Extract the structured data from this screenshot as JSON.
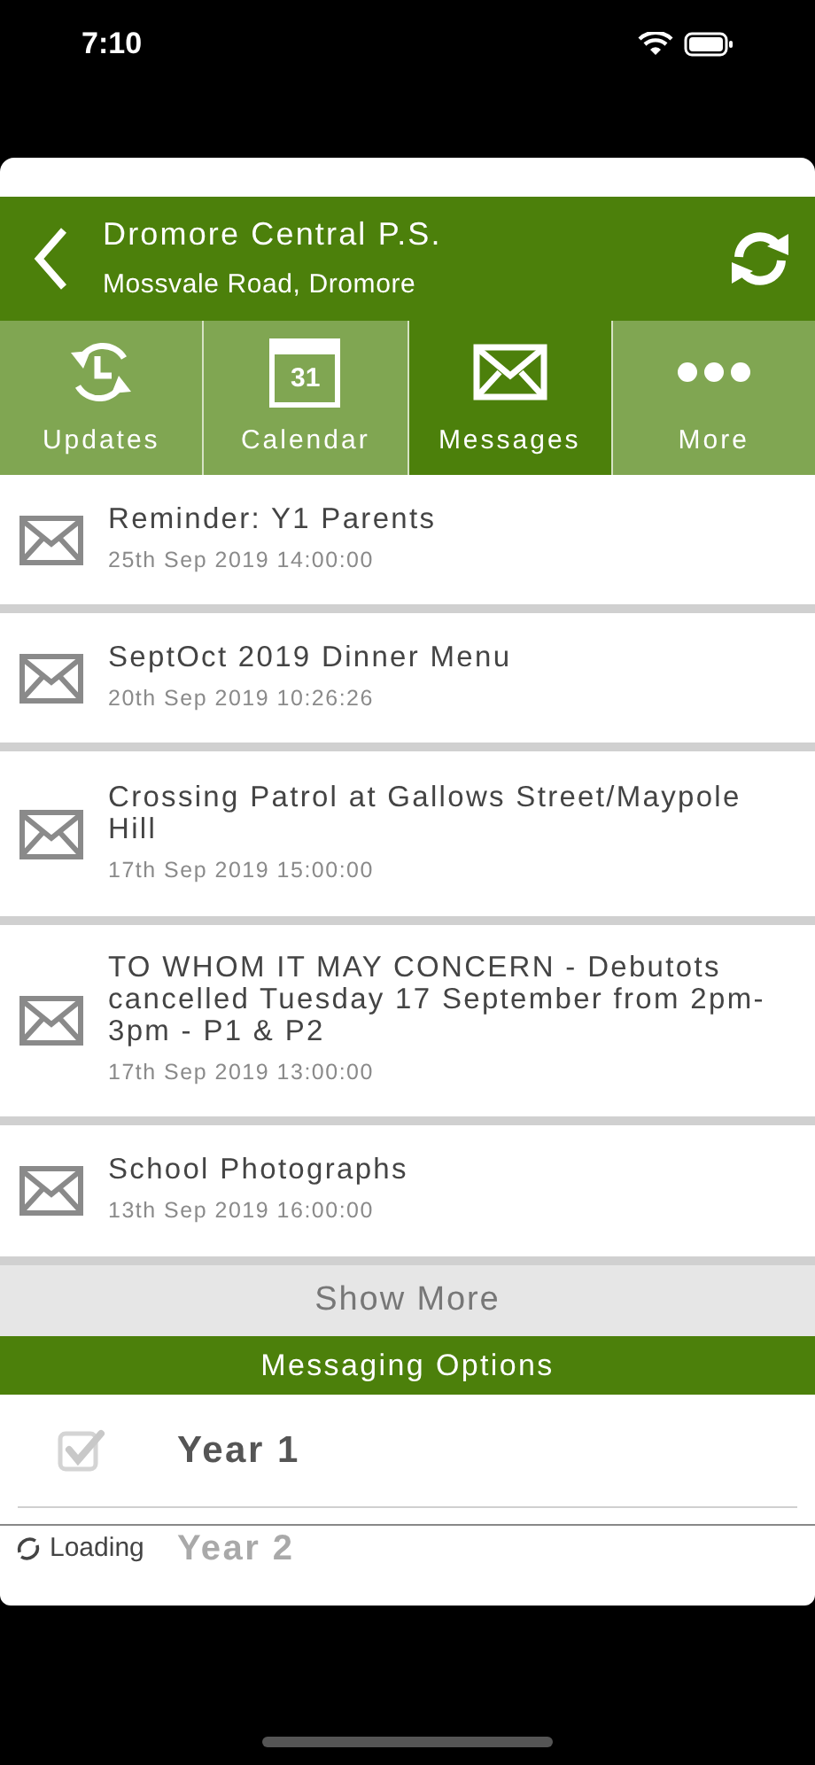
{
  "status_bar": {
    "time": "7:10"
  },
  "header": {
    "title": "Dromore Central P.S.",
    "subtitle": "Mossvale Road, Dromore"
  },
  "tabs": [
    {
      "label": "Updates",
      "kind": "updates",
      "selected": false
    },
    {
      "label": "Calendar",
      "kind": "calendar",
      "calendar_day": "31",
      "selected": false
    },
    {
      "label": "Messages",
      "kind": "messages",
      "selected": true
    },
    {
      "label": "More",
      "kind": "more",
      "selected": false
    }
  ],
  "messages": [
    {
      "title": "Reminder: Y1 Parents",
      "date": "25th Sep 2019 14:00:00"
    },
    {
      "title": "SeptOct 2019 Dinner Menu",
      "date": "20th Sep 2019 10:26:26"
    },
    {
      "title": "Crossing Patrol at Gallows Street/Maypole Hill",
      "date": "17th Sep 2019 15:00:00"
    },
    {
      "title": "TO WHOM IT MAY CONCERN - Debutots cancelled Tuesday 17 September from 2pm-3pm - P1 & P2",
      "date": "17th Sep 2019 13:00:00"
    },
    {
      "title": "School Photographs",
      "date": "13th Sep 2019 16:00:00"
    }
  ],
  "show_more": "Show More",
  "messaging_options": {
    "title": "Messaging Options",
    "options": [
      {
        "label": "Year 1",
        "checked": true
      },
      {
        "label": "Year 2"
      }
    ]
  },
  "loading": "Loading"
}
